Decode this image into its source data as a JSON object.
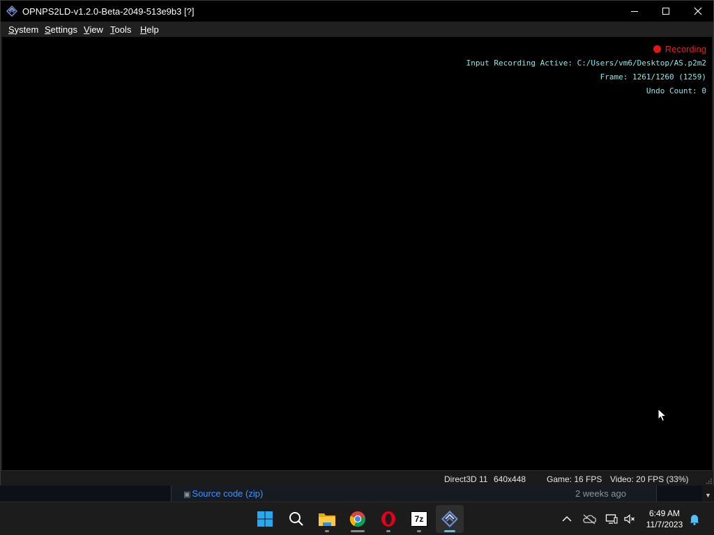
{
  "window": {
    "title": "OPNPS2LD-v1.2.0-Beta-2049-513e9b3 [?]"
  },
  "menu": {
    "items": [
      "System",
      "Settings",
      "View",
      "Tools",
      "Help"
    ]
  },
  "osd": {
    "recording": "Recording",
    "input_recording": "Input Recording Active: C:/Users/vm6/Desktop/AS.p2m2",
    "frame": "Frame: 1261/1260 (1259)",
    "undo": "Undo Count: 0"
  },
  "status": {
    "renderer": "Direct3D 11",
    "resolution": "640x448",
    "game_fps": "Game: 16 FPS",
    "video_fps": "Video: 20 FPS (33%)"
  },
  "background": {
    "link": "Source code (zip)",
    "date": "2 weeks ago"
  },
  "taskbar": {
    "apps": [
      "start-icon",
      "search-icon",
      "file-explorer-icon",
      "chrome-icon",
      "opera-icon",
      "7zip-icon",
      "pcsx2-icon"
    ],
    "sevenzip_label": "7z",
    "time": "6:49 AM",
    "date": "11/7/2023"
  },
  "colors": {
    "osd_text": "#8fe6e6",
    "recording": "#e32020",
    "taskbar_active": "#4cc2ff"
  }
}
